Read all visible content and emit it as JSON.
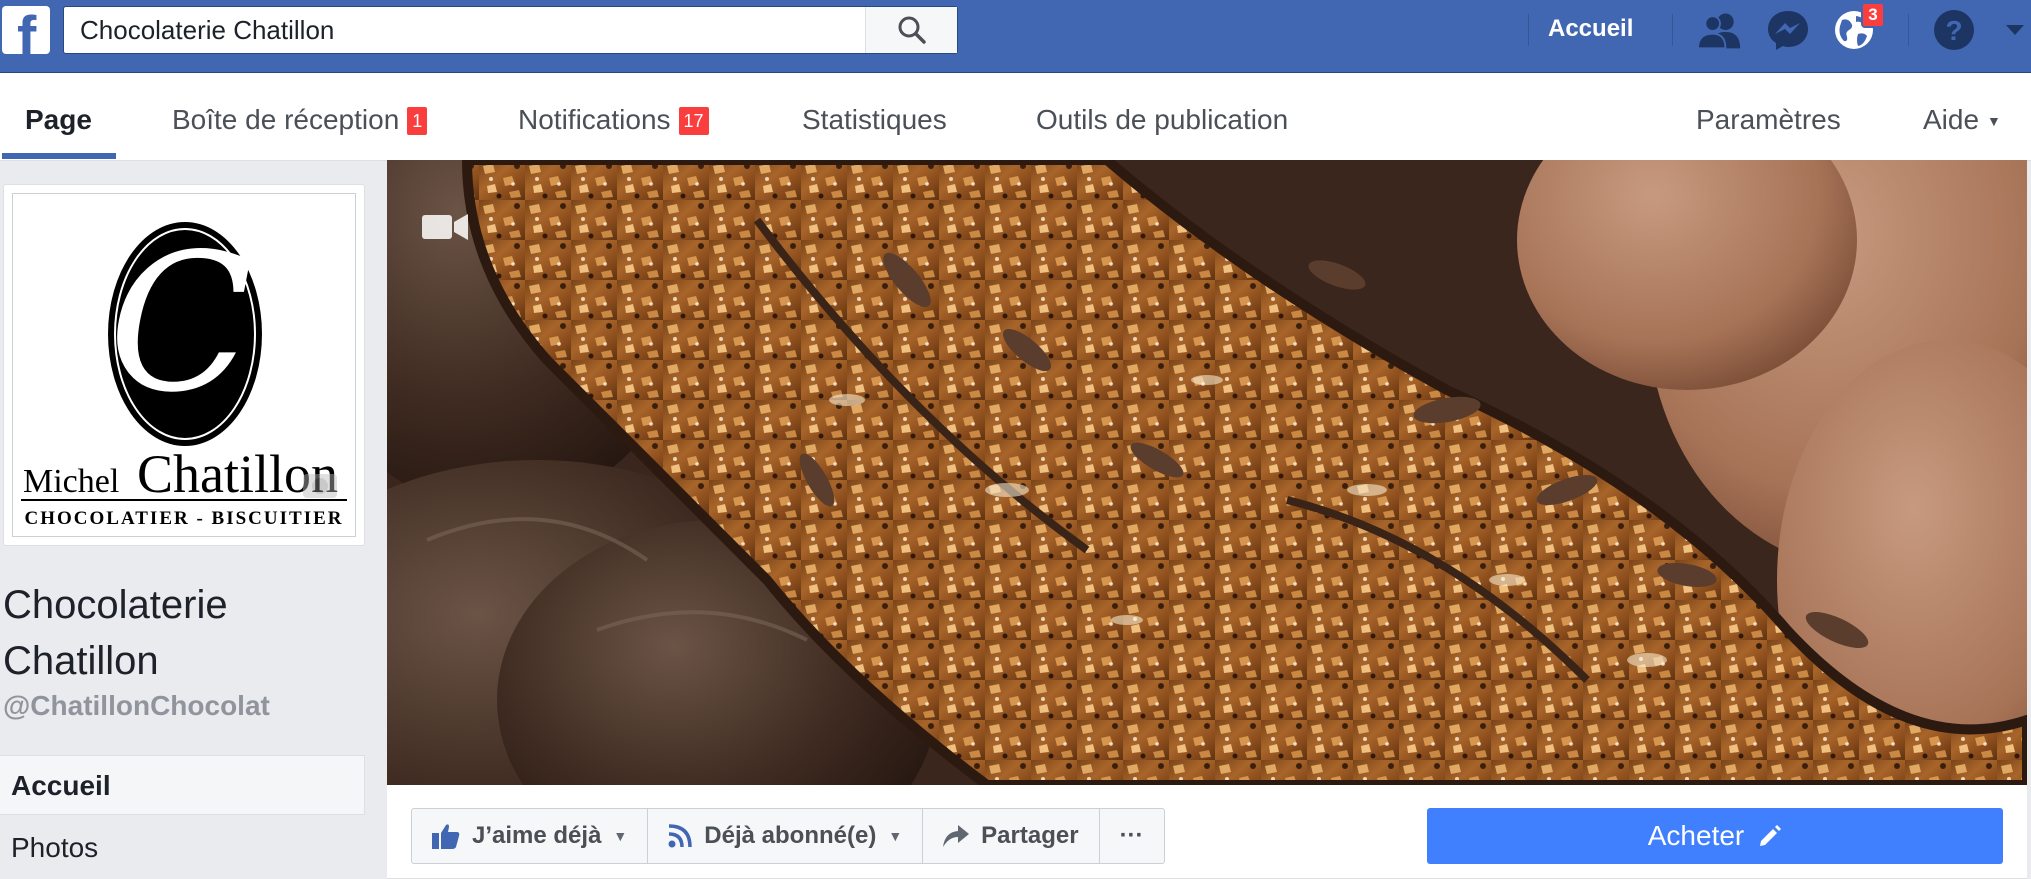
{
  "topbar": {
    "search_value": "Chocolaterie Chatillon",
    "home_label": "Accueil",
    "notifications_badge": "3",
    "brand_color": "#4267b2"
  },
  "pagenav": {
    "tabs": [
      {
        "label": "Page",
        "active": true
      },
      {
        "label": "Boîte de réception",
        "badge": "1"
      },
      {
        "label": "Notifications",
        "badge": "17"
      },
      {
        "label": "Statistiques"
      },
      {
        "label": "Outils de publication"
      },
      {
        "label": "Paramètres"
      },
      {
        "label": "Aide"
      }
    ]
  },
  "profile": {
    "logo_first_name": "Michel",
    "logo_last_name": "Chatillon",
    "logo_tagline": "CHOCOLATIER - BISCUITIER",
    "logo_monogram": "C",
    "name_line1": "Chocolaterie",
    "name_line2": "Chatillon",
    "handle": "@ChatillonChocolat"
  },
  "left_nav": {
    "items": [
      {
        "label": "Accueil",
        "active": true
      },
      {
        "label": "Photos"
      }
    ]
  },
  "actions": {
    "like_label": "J’aime déjà",
    "follow_label": "Déjà abonné(e)",
    "share_label": "Partager",
    "more_label": "···",
    "buy_label": "Acheter",
    "buy_color": "#4080ff"
  }
}
